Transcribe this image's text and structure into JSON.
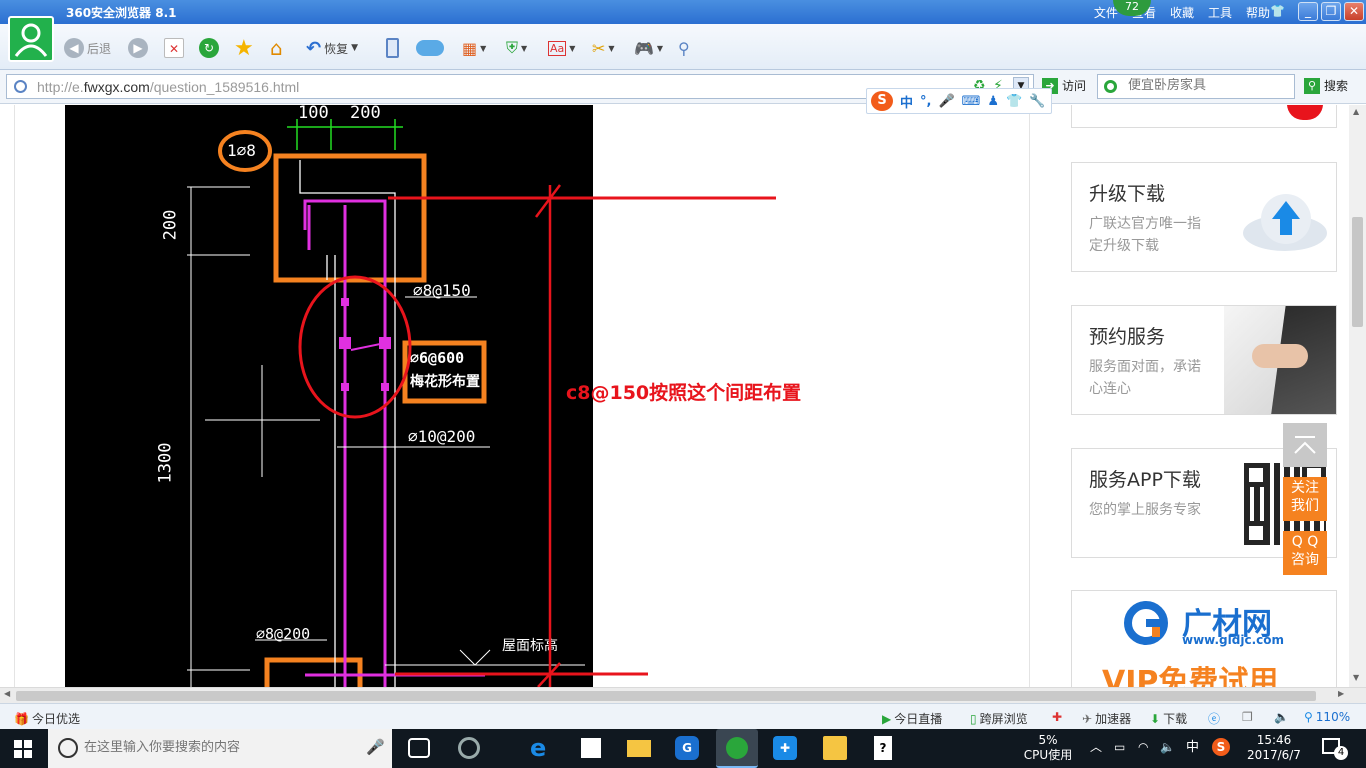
{
  "titlebar": {
    "title": "360安全浏览器 8.1",
    "badge": "72",
    "menus": [
      "文件",
      "查看",
      "收藏",
      "工具",
      "帮助"
    ]
  },
  "toolbar": {
    "back_label": "后退",
    "restore_label": "恢复"
  },
  "address": {
    "url_prefix": "http://e.",
    "url_domain": "fwxgx.com",
    "url_path": "/question_1589516.html",
    "visit_label": "访问",
    "search_placeholder": "便宜卧房家具",
    "search_button": "搜索"
  },
  "ime": {
    "mode": "中",
    "punct": "°,"
  },
  "cad_drawing": {
    "dim_top_left": "100",
    "dim_top_right": "200",
    "dim_side_upper": "200",
    "dim_side_lower": "1300",
    "label_circle": "1⌀8",
    "rebar_1": "⌀8@150",
    "rebar_2": "⌀10@200",
    "rebar_3": "⌀8@200",
    "box_line1": "⌀6@600",
    "box_line2": "梅花形布置",
    "elev_label": "屋面标高"
  },
  "annotation": {
    "text": "c8@150按照这个间距布置"
  },
  "sidebar": {
    "cards": [
      {
        "title": "升级下载",
        "desc": "广联达官方唯一指定升级下载"
      },
      {
        "title": "预约服务",
        "desc": "服务面对面，承诺心连心"
      },
      {
        "title": "服务APP下载",
        "desc": "您的掌上服务专家"
      }
    ],
    "ad_brand": "广材网",
    "ad_url": "www.gldjc.com",
    "ad_slogan": "VIP免费试用",
    "follow_us": "关注我们",
    "qq_consult": "Q Q 咨询"
  },
  "statusbar": {
    "left": "今日优选",
    "items": [
      "今日直播",
      "跨屏浏览",
      "加速器",
      "下载"
    ],
    "zoom": "110%"
  },
  "taskbar": {
    "search_placeholder": "在这里输入你要搜索的内容",
    "cpu_percent": "5%",
    "cpu_label": "CPU使用",
    "ime": "中",
    "time": "15:46",
    "date": "2017/6/7",
    "notifications": "4"
  },
  "colors": {
    "titlebar": "#2b6fd1",
    "cad_bg": "#000000",
    "annotation_red": "#e8141c",
    "orange": "#f58220",
    "magenta": "#e030e0",
    "taskbar": "#101820"
  }
}
